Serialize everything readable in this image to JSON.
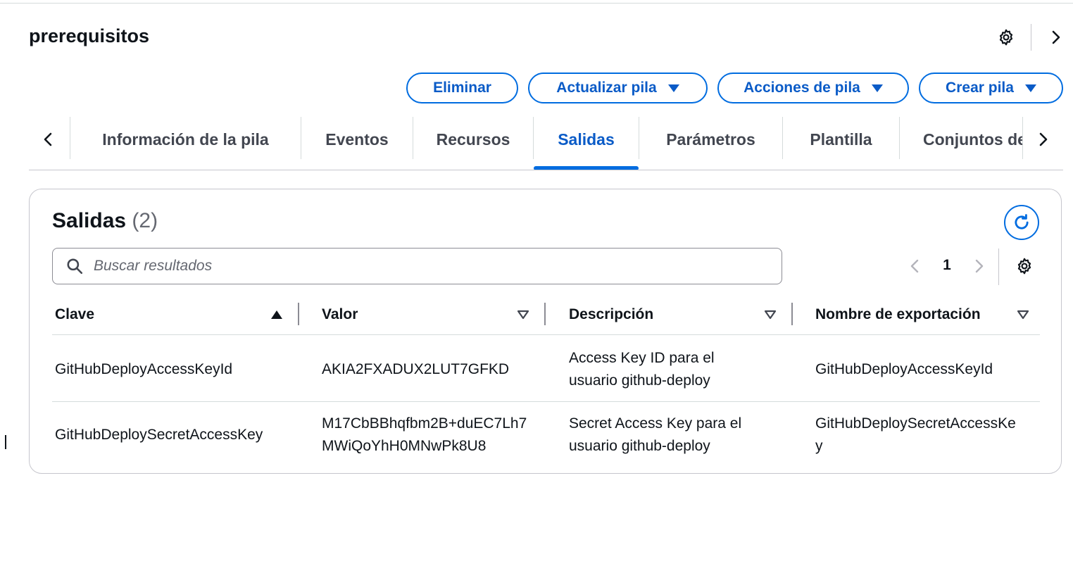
{
  "header": {
    "title": "prerequisitos",
    "actions": {
      "delete": "Eliminar",
      "update": "Actualizar pila",
      "stack_actions": "Acciones de pila",
      "create": "Crear pila"
    }
  },
  "tabs": [
    {
      "label": "Información de la pila"
    },
    {
      "label": "Eventos"
    },
    {
      "label": "Recursos"
    },
    {
      "label": "Salidas",
      "active": true
    },
    {
      "label": "Parámetros"
    },
    {
      "label": "Plantilla"
    },
    {
      "label": "Conjuntos de cambios"
    }
  ],
  "outputs": {
    "title": "Salidas",
    "count": "(2)",
    "search_placeholder": "Buscar resultados",
    "page": "1",
    "columns": [
      "Clave",
      "Valor",
      "Descripción",
      "Nombre de exportación"
    ],
    "rows": [
      {
        "key": "GitHubDeployAccessKeyId",
        "value": "AKIA2FXADUX2LUT7GFKD",
        "description": "Access Key ID para el usuario github-deploy",
        "export_name": "GitHubDeployAccessKeyId"
      },
      {
        "key": "GitHubDeploySecretAccessKey",
        "value": "M17CbBBhqfbm2B+duEC7Lh7MWiQoYhH0MNwPk8U8",
        "description": "Secret Access Key para el usuario github-deploy",
        "export_name": "GitHubDeploySecretAccessKey"
      }
    ]
  },
  "colors": {
    "accent": "#006ce0",
    "accent_text": "#0a5bc7",
    "text": "#0f141a",
    "muted": "#656871",
    "border": "#c6c6cd"
  }
}
